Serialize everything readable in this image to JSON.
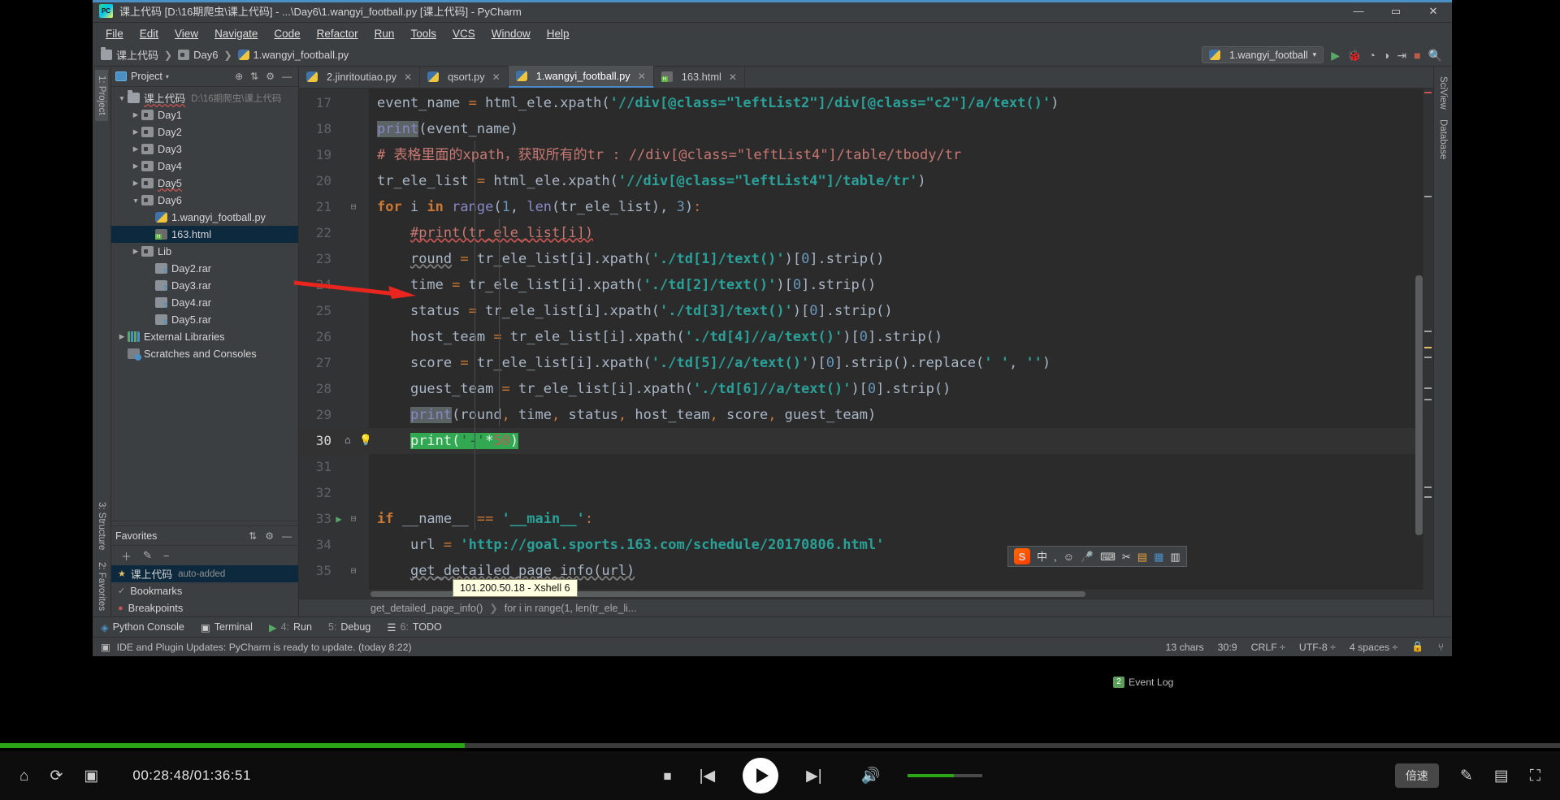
{
  "window": {
    "title": "课上代码 [D:\\16期爬虫\\课上代码] - ...\\Day6\\1.wangyi_football.py [课上代码] - PyCharm",
    "minimize": "—",
    "maximize": "▭",
    "close": "✕",
    "logo": "pycharm-logo"
  },
  "menubar": [
    "File",
    "Edit",
    "View",
    "Navigate",
    "Code",
    "Refactor",
    "Run",
    "Tools",
    "VCS",
    "Window",
    "Help"
  ],
  "breadcrumb": [
    {
      "label": "课上代码",
      "icon": "folder-icon"
    },
    {
      "label": "Day6",
      "icon": "module-folder-icon"
    },
    {
      "label": "1.wangyi_football.py",
      "icon": "python-file-icon"
    }
  ],
  "run_config": {
    "label": "1.wangyi_football",
    "icon": "python-file-icon",
    "caret": "▾"
  },
  "nav_icons": [
    "run-icon",
    "debug-icon",
    "coverage-icon",
    "profile-icon",
    "attach-icon",
    "stop-icon",
    "search-icon"
  ],
  "left_strip": [
    {
      "label": "1: Project",
      "selected": true
    }
  ],
  "right_strip": [
    "SciView",
    "Database"
  ],
  "project_pane": {
    "title": "Project",
    "caret": "▾",
    "actions": [
      "target-icon",
      "collapse-all-icon",
      "gear-icon",
      "hide-icon"
    ],
    "tree": [
      {
        "depth": 0,
        "arrow": "▼",
        "icon": "folder-icon",
        "label": "课上代码",
        "path": "D:\\16期爬虫\\课上代码",
        "selected": false,
        "underline": true
      },
      {
        "depth": 1,
        "arrow": "▶",
        "icon": "module-folder-icon",
        "label": "Day1",
        "path": "",
        "selected": false
      },
      {
        "depth": 1,
        "arrow": "▶",
        "icon": "module-folder-icon",
        "label": "Day2",
        "path": "",
        "selected": false
      },
      {
        "depth": 1,
        "arrow": "▶",
        "icon": "module-folder-icon",
        "label": "Day3",
        "path": "",
        "selected": false
      },
      {
        "depth": 1,
        "arrow": "▶",
        "icon": "module-folder-icon",
        "label": "Day4",
        "path": "",
        "selected": false
      },
      {
        "depth": 1,
        "arrow": "▶",
        "icon": "module-folder-icon",
        "label": "Day5",
        "path": "",
        "selected": false,
        "underline": true
      },
      {
        "depth": 1,
        "arrow": "▼",
        "icon": "module-folder-icon",
        "label": "Day6",
        "path": "",
        "selected": false
      },
      {
        "depth": 2,
        "arrow": "",
        "icon": "python-file-icon",
        "label": "1.wangyi_football.py",
        "path": "",
        "selected": false
      },
      {
        "depth": 2,
        "arrow": "",
        "icon": "html-file-icon",
        "label": "163.html",
        "path": "",
        "selected": true
      },
      {
        "depth": 1,
        "arrow": "▶",
        "icon": "module-folder-icon",
        "label": "Lib",
        "path": "",
        "selected": false
      },
      {
        "depth": 2,
        "arrow": "",
        "icon": "rar-file-icon",
        "label": "Day2.rar",
        "path": "",
        "selected": false
      },
      {
        "depth": 2,
        "arrow": "",
        "icon": "rar-file-icon",
        "label": "Day3.rar",
        "path": "",
        "selected": false
      },
      {
        "depth": 2,
        "arrow": "",
        "icon": "rar-file-icon",
        "label": "Day4.rar",
        "path": "",
        "selected": false
      },
      {
        "depth": 2,
        "arrow": "",
        "icon": "rar-file-icon",
        "label": "Day5.rar",
        "path": "",
        "selected": false
      },
      {
        "depth": 0,
        "arrow": "▶",
        "icon": "external-libraries-icon",
        "label": "External Libraries",
        "path": "",
        "selected": false
      },
      {
        "depth": 0,
        "arrow": "",
        "icon": "scratches-icon",
        "label": "Scratches and Consoles",
        "path": "",
        "selected": false
      }
    ]
  },
  "favorites_pane": {
    "title": "Favorites",
    "actions": [
      "collapse-all-icon",
      "gear-icon",
      "hide-icon"
    ],
    "toolbar": [
      "＋",
      "✎",
      "−"
    ],
    "items": [
      {
        "icon": "★",
        "label": "课上代码",
        "sub": "auto-added",
        "selected": true
      },
      {
        "icon": "✓",
        "label": "Bookmarks",
        "sub": "",
        "selected": false
      },
      {
        "icon": "●",
        "label": "Breakpoints",
        "sub": "",
        "selected": false
      }
    ]
  },
  "editor_tabs": [
    {
      "label": "2.jinritoutiao.py",
      "icon": "python-file-icon",
      "active": false,
      "close": "✕"
    },
    {
      "label": "qsort.py",
      "icon": "python-file-icon",
      "active": false,
      "close": "✕"
    },
    {
      "label": "1.wangyi_football.py",
      "icon": "python-file-icon",
      "active": true,
      "close": "✕"
    },
    {
      "label": "163.html",
      "icon": "html-file-icon",
      "active": false,
      "close": "✕"
    }
  ],
  "code": {
    "first_line": 17,
    "current_line": 30,
    "lines": [
      {
        "n": 17,
        "html": "<span class='s-txt'>event_name </span><span class='s-kw2'>= </span><span class='s-txt'>html_ele.xpath(</span><span class='s-str'>'//div[@class=\"leftList2\"]/div[@class=\"c2\"]/a/text()'</span><span class='s-txt'>)</span>"
      },
      {
        "n": 18,
        "html": "<span class='s-bi s-sel'>print</span><span class='s-txt'>(event_name)</span>"
      },
      {
        "n": 19,
        "html": "<span class='s-cmtcn'># 表格里面的xpath，获取所有的tr : //div[@class=\"leftList4\"]/table/tbody/tr</span>"
      },
      {
        "n": 20,
        "html": "<span class='s-txt'>tr_ele_list </span><span class='s-kw2'>= </span><span class='s-txt'>html_ele.xpath(</span><span class='s-str'>'//div[@class=\"leftList4\"]/table/tr'</span><span class='s-txt'>)</span>"
      },
      {
        "n": 21,
        "html": "<span class='s-kw'>for </span><span class='s-txt'>i </span><span class='s-kw'>in </span><span class='s-bi'>range</span><span class='s-txt'>(</span><span class='s-num'>1</span><span class='s-txt'>, </span><span class='s-bi'>len</span><span class='s-txt'>(tr_ele_list), </span><span class='s-num'>3</span><span class='s-txt'>)</span><span class='s-kw2'>:</span>"
      },
      {
        "n": 22,
        "html": "    <span class='s-cmtcn wavy-red'>#print(tr_ele_list[i])</span>"
      },
      {
        "n": 23,
        "html": "    <span class='s-txt wavy'>round</span><span class='s-txt'> </span><span class='s-kw2'>= </span><span class='s-txt'>tr_ele_list[i].xpath(</span><span class='s-str'>'./td[1]/text()'</span><span class='s-txt'>)[</span><span class='s-num'>0</span><span class='s-txt'>].strip()</span>"
      },
      {
        "n": 24,
        "html": "    <span class='s-txt'>time </span><span class='s-kw2'>= </span><span class='s-txt'>tr_ele_list[i].xpath(</span><span class='s-str'>'./td[2]/text()'</span><span class='s-txt'>)[</span><span class='s-num'>0</span><span class='s-txt'>].strip()</span>"
      },
      {
        "n": 25,
        "html": "    <span class='s-txt'>status </span><span class='s-kw2'>= </span><span class='s-txt'>tr_ele_list[i].xpath(</span><span class='s-str'>'./td[3]/text()'</span><span class='s-txt'>)[</span><span class='s-num'>0</span><span class='s-txt'>].strip()</span>"
      },
      {
        "n": 26,
        "html": "    <span class='s-txt'>host_team </span><span class='s-kw2'>= </span><span class='s-txt'>tr_ele_list[i].xpath(</span><span class='s-str'>'./td[4]//a/text()'</span><span class='s-txt'>)[</span><span class='s-num'>0</span><span class='s-txt'>].strip()</span>"
      },
      {
        "n": 27,
        "html": "    <span class='s-txt'>score </span><span class='s-kw2'>= </span><span class='s-txt'>tr_ele_list[i].xpath(</span><span class='s-str'>'./td[5]//a/text()'</span><span class='s-txt'>)[</span><span class='s-num'>0</span><span class='s-txt'>].strip().replace(</span><span class='s-str'>' '</span><span class='s-txt'>, </span><span class='s-str'>''</span><span class='s-txt'>)</span>"
      },
      {
        "n": 28,
        "html": "    <span class='s-txt'>guest_team </span><span class='s-kw2'>= </span><span class='s-txt'>tr_ele_list[i].xpath(</span><span class='s-str'>'./td[6]//a/text()'</span><span class='s-txt'>)[</span><span class='s-num'>0</span><span class='s-txt'>].strip()</span>"
      },
      {
        "n": 29,
        "html": "    <span class='s-bi s-sel'>print</span><span class='s-txt'>(round</span><span class='s-kw2'>, </span><span class='s-txt'>time</span><span class='s-kw2'>, </span><span class='s-txt'>status</span><span class='s-kw2'>, </span><span class='s-txt'>host_team</span><span class='s-kw2'>, </span><span class='s-txt'>score</span><span class='s-kw2'>, </span><span class='s-txt'>guest_team)</span>"
      },
      {
        "n": 30,
        "html": "    <span class='s-green-bg'>print(<span style='color:#1e5f2e'>'-'</span>*<span style='color:#c05a5a'>50</span>)</span>"
      },
      {
        "n": 31,
        "html": ""
      },
      {
        "n": 32,
        "html": ""
      },
      {
        "n": 33,
        "html": "<span class='s-kw'>if </span><span class='s-txt'>__name__ </span><span class='s-kw2'>== </span><span class='s-str'>'__main__'</span><span class='s-kw2'>:</span>"
      },
      {
        "n": 34,
        "html": "    <span class='s-txt'>url </span><span class='s-kw2'>= </span><span class='s-str'>'http://goal.sports.163.com/schedule/20170806.html'</span>"
      },
      {
        "n": 35,
        "html": "    <span class='s-txt wavy'>get_detailed_page_info(url)</span>"
      }
    ],
    "bottom_breadcrumb": [
      "get_detailed_page_info()",
      "for i in range(1, len(tr_ele_li..."
    ]
  },
  "bottom_tabs": [
    {
      "key": "",
      "label": "Python Console",
      "icon": "python-console-icon"
    },
    {
      "key": "",
      "label": "Terminal",
      "icon": "terminal-icon"
    },
    {
      "key": "4:",
      "label": "Run",
      "icon": "run-icon"
    },
    {
      "key": "5:",
      "label": "Debug",
      "icon": "debug-icon"
    },
    {
      "key": "6:",
      "label": "TODO",
      "icon": "todo-icon"
    }
  ],
  "statusbar": {
    "message": "IDE and Plugin Updates: PyCharm is ready to update. (today 8:22)",
    "chars": "13 chars",
    "caret": "30:9",
    "line_sep": "CRLF ÷",
    "encoding": "UTF-8 ÷",
    "indent": "4 spaces ÷",
    "lock_icon": "lock-icon",
    "branch_icon": "branch-icon",
    "event_log": "Event Log",
    "event_badge": "2"
  },
  "tooltip": {
    "xshell": "101.200.50.18 - Xshell 6"
  },
  "tray": {
    "items": [
      "sogou-logo",
      "中",
      "·,",
      "☺",
      "🎤",
      "⌨",
      "✂",
      "📋",
      "🔧",
      "▦"
    ]
  },
  "player": {
    "time_current": "00:28:48",
    "time_total": "01:36:51",
    "time_display": "00:28:48/01:36:51",
    "progress_percent": 29.8,
    "volume_percent": 62,
    "speed_label": "倍速",
    "icons": {
      "home": "home-icon",
      "refresh": "refresh-icon",
      "screenshot": "screenshot-icon",
      "stop": "stop-icon",
      "prev": "previous-icon",
      "play": "play-icon",
      "next": "next-icon",
      "volume": "volume-icon",
      "settings": "settings-icon",
      "pip": "picture-in-picture-icon",
      "fullscreen": "fullscreen-icon"
    }
  },
  "colors": {
    "accent_blue": "#4a90c4",
    "ide_bg": "#3c3f41",
    "editor_bg": "#2b2b2b",
    "highlight_green": "#32a852",
    "progress_green": "#2aa515",
    "selected_tree": "#0d293e",
    "annotation_red": "#e8251f"
  }
}
